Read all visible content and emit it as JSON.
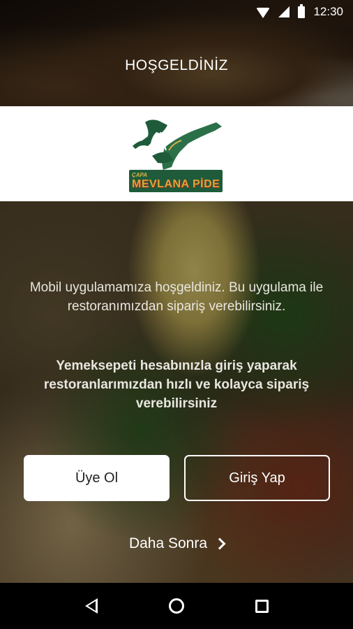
{
  "status_bar": {
    "time": "12:30",
    "icons": [
      "wifi-icon",
      "signal-icon",
      "battery-icon"
    ]
  },
  "header": {
    "title": "HOŞGELDİNİZ"
  },
  "logo": {
    "sub_text": "ÇAPA",
    "main_text": "MEVLANA PİDE",
    "brand_color": "#1f5b3a",
    "accent_color": "#e0a33a"
  },
  "main": {
    "welcome_text": "Mobil uygulamamıza hoşgeldiniz. Bu uygulama ile restoranımızdan sipariş verebilirsiniz.",
    "login_info_text": "Yemeksepeti hesabınızla giriş yaparak restoranlarımızdan hızlı ve kolayca sipariş verebilirsiniz",
    "register_button": "Üye Ol",
    "login_button": "Giriş Yap",
    "later_link": "Daha Sonra"
  },
  "navbar": {
    "icons": [
      "back-icon",
      "home-icon",
      "recents-icon"
    ]
  }
}
